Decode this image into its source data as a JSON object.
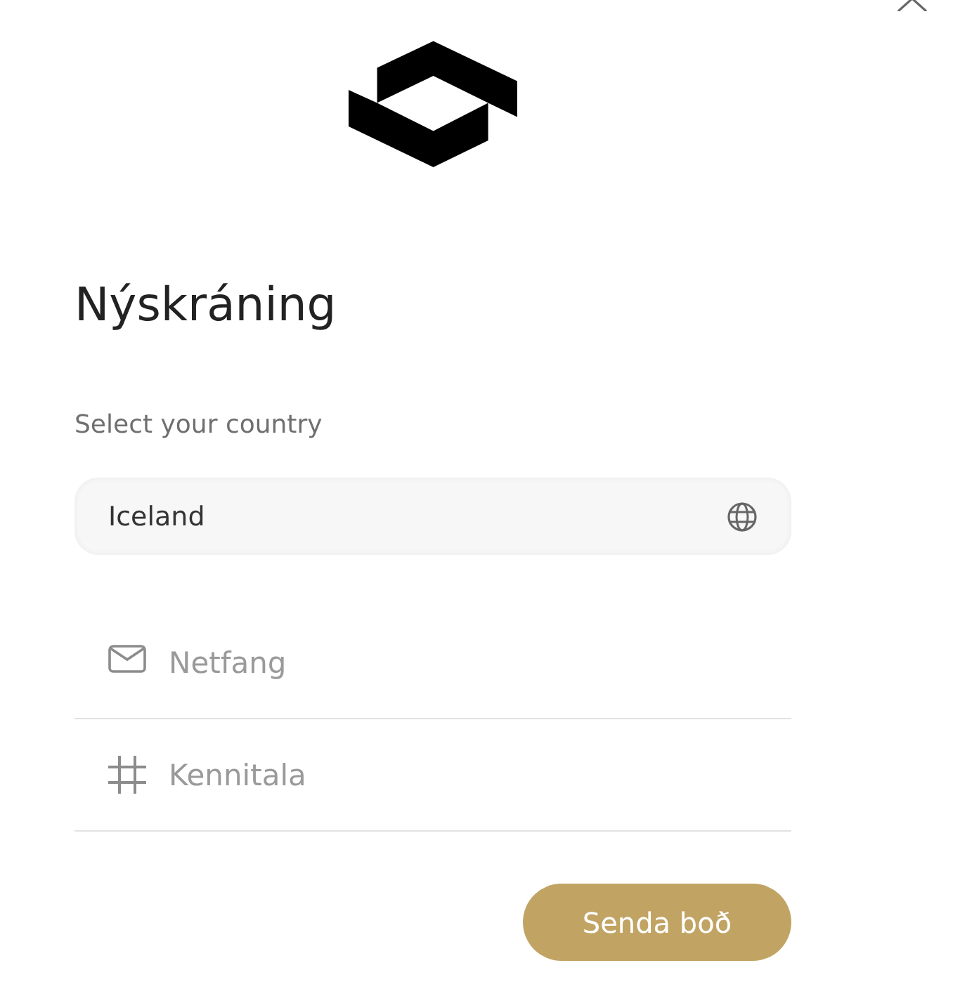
{
  "title": "Nýskráning",
  "country": {
    "label": "Select your country",
    "value": "Iceland"
  },
  "fields": [
    {
      "kind": "email",
      "placeholder": "Netfang"
    },
    {
      "kind": "number",
      "placeholder": "Kennitala"
    }
  ],
  "submit_button": {
    "label": "Senda boð"
  }
}
